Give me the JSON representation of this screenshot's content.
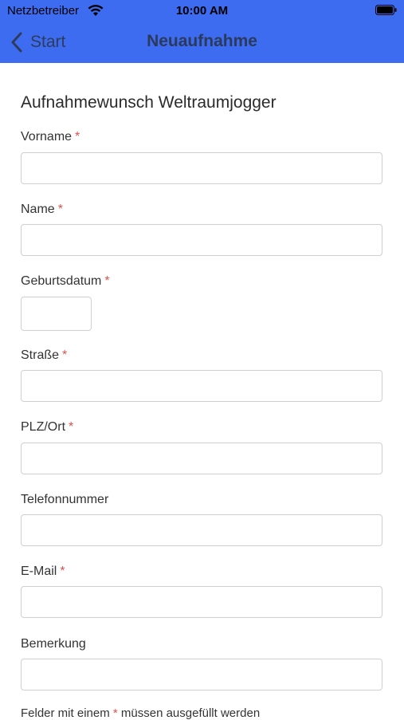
{
  "status": {
    "carrier": "Netzbetreiber",
    "time": "10:00 AM"
  },
  "nav": {
    "back_label": "Start",
    "title": "Neuaufnahme"
  },
  "form": {
    "title": "Aufnahmewunsch Weltraumjogger",
    "fields": [
      {
        "label": "Vorname",
        "required": "*"
      },
      {
        "label": "Name",
        "required": "*"
      },
      {
        "label": "Geburtsdatum",
        "required": "*"
      },
      {
        "label": "Straße",
        "required": "*"
      },
      {
        "label": "PLZ/Ort",
        "required": "*"
      },
      {
        "label": "Telefonnummer"
      },
      {
        "label": "E-Mail",
        "required": "*"
      },
      {
        "label": "Bemerkung"
      }
    ],
    "footer_note_before": "Felder mit einem",
    "footer_note_star": "*",
    "footer_note_after": "müssen ausgefüllt werden"
  },
  "colors": {
    "header": "#3d6cf0",
    "required_star": "#d9534f"
  }
}
